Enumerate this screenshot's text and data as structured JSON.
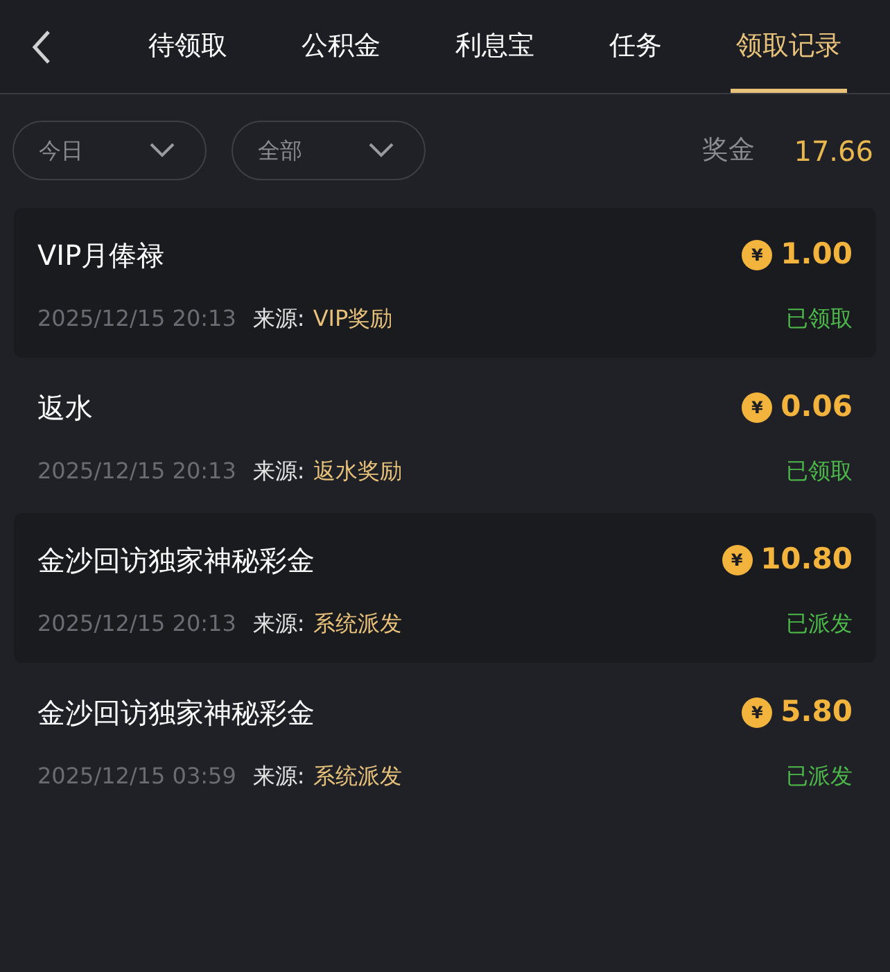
{
  "tabs": [
    {
      "label": "待领取",
      "selected": false
    },
    {
      "label": "公积金",
      "selected": false
    },
    {
      "label": "利息宝",
      "selected": false
    },
    {
      "label": "任务",
      "selected": false
    },
    {
      "label": "领取记录",
      "selected": true
    }
  ],
  "filters": [
    {
      "label": "今日"
    },
    {
      "label": "全部"
    }
  ],
  "bonus": {
    "label": "奖金",
    "value": "17.66"
  },
  "records": [
    {
      "title": "VIP月俸禄",
      "currency": "¥",
      "amount": "1.00",
      "time": "2025/12/15 20:13",
      "source_label": "来源:",
      "source": "VIP奖励",
      "status": "已领取"
    },
    {
      "title": "返水",
      "currency": "¥",
      "amount": "0.06",
      "time": "2025/12/15 20:13",
      "source_label": "来源:",
      "source": "返水奖励",
      "status": "已领取"
    },
    {
      "title": "金沙回访独家神秘彩金",
      "currency": "¥",
      "amount": "10.80",
      "time": "2025/12/15 20:13",
      "source_label": "来源:",
      "source": "系统派发",
      "status": "已派发"
    },
    {
      "title": "金沙回访独家神秘彩金",
      "currency": "¥",
      "amount": "5.80",
      "time": "2025/12/15 03:59",
      "source_label": "来源:",
      "source": "系统派发",
      "status": "已派发"
    }
  ]
}
